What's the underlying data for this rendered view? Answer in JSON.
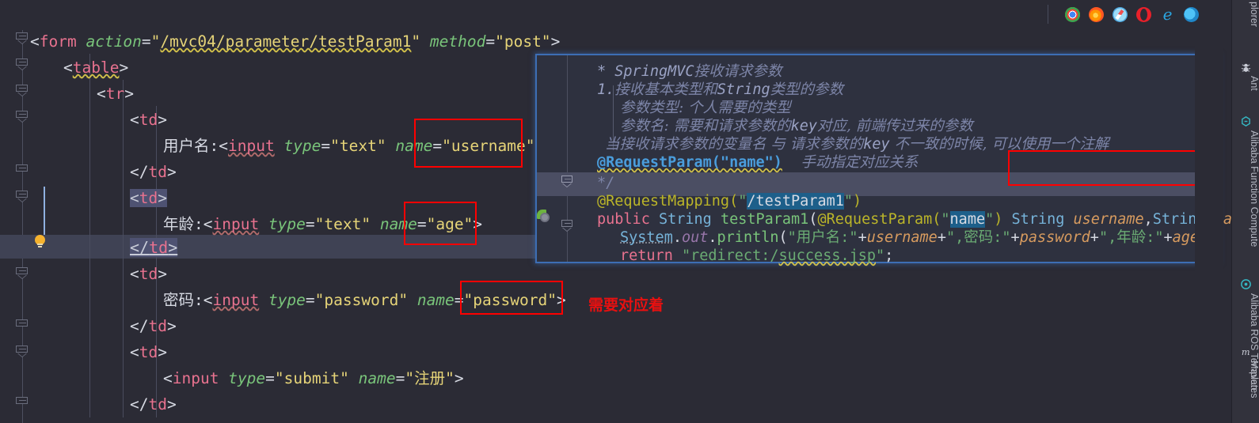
{
  "editor": {
    "file_language": "jsp",
    "lines": [
      {
        "id": "l1",
        "indent": 0,
        "text": "<form action=\"/mvc04/parameter/testParam1\" method=\"post\">"
      },
      {
        "id": "l2",
        "indent": 1,
        "text": "<table>"
      },
      {
        "id": "l3",
        "indent": 2,
        "text": "<tr>"
      },
      {
        "id": "l4",
        "indent": 3,
        "text": "<td>"
      },
      {
        "id": "l5",
        "indent": 4,
        "text": "用户名:<input type=\"text\" name=\"username\">"
      },
      {
        "id": "l6",
        "indent": 3,
        "text": "</td>"
      },
      {
        "id": "l7",
        "indent": 3,
        "text": "<td>"
      },
      {
        "id": "l8",
        "indent": 4,
        "text": "年龄:<input type=\"text\" name=\"age\">"
      },
      {
        "id": "l9",
        "indent": 3,
        "text": "</td>"
      },
      {
        "id": "l10",
        "indent": 3,
        "text": "<td>"
      },
      {
        "id": "l11",
        "indent": 4,
        "text": "密码:<input type=\"password\" name=\"password\">"
      },
      {
        "id": "l12",
        "indent": 3,
        "text": "</td>"
      },
      {
        "id": "l13",
        "indent": 3,
        "text": "<td>"
      },
      {
        "id": "l14",
        "indent": 4,
        "text": "<input type=\"submit\" name=\"注册\">"
      },
      {
        "id": "l15",
        "indent": 3,
        "text": "</td>"
      }
    ],
    "current_line_text": "</td>",
    "annotations": {
      "note_text": "需要对应着",
      "box_color": "#ff0000",
      "highlight_boxes": [
        "\"username\">",
        "\"age\">",
        "\"password\">"
      ]
    },
    "gutter": {
      "intention_bulb": "lightbulb-icon"
    }
  },
  "popup": {
    "title": "documentation-popup",
    "border_color": "#3d6eb4",
    "javadoc": [
      {
        "id": "d1",
        "text": "* SpringMVC接收请求参数"
      },
      {
        "id": "d2",
        "text": "1.接收基本类型和String类型的参数"
      },
      {
        "id": "d3",
        "text": "参数类型: 个人需要的类型"
      },
      {
        "id": "d4",
        "text": "参数名: 需要和请求参数的key对应, 前端传过来的参数"
      },
      {
        "id": "d5",
        "text": "当接收请求参数的变量名 与 请求参数的key 不一致的时候, 可以使用一个注解"
      },
      {
        "id": "d6",
        "annotation": "@RequestParam(\"name\")",
        "text": "手动指定对应关系"
      },
      {
        "id": "d7",
        "text": "*/"
      }
    ],
    "code": {
      "mapping_annotation": "@RequestMapping(\"/testParam1\")",
      "mapping_path": "/testParam1",
      "signature_prefix": "public String testParam1(@RequestParam(\"name\") String ",
      "signature_param_name": "name",
      "signature_boxed": "username,String password,Integer age)",
      "signature_suffix": "{",
      "println_line": "System.out.println(\"用户名:\"+username+\",密码:\"+password+\",年龄:\"+age);",
      "return_line": "return \"redirect:/success.jsp\";",
      "bean_icon": "spring-bean-icon"
    }
  },
  "right_sidebar": {
    "items": [
      {
        "id": "s1",
        "label": "plorer",
        "icon": ""
      },
      {
        "id": "s2",
        "label": "Ant",
        "icon": "ant-icon"
      },
      {
        "id": "s3",
        "label": "Alibaba Function Compute",
        "icon": "alibaba-fc-icon"
      },
      {
        "id": "s4",
        "label": "Alibaba ROS Templates",
        "icon": "alibaba-ros-icon"
      },
      {
        "id": "s5",
        "label": "Maven",
        "icon": "maven-icon"
      }
    ]
  },
  "browser_bar": {
    "icons": [
      {
        "id": "b1",
        "name": "chrome-icon",
        "color": "#4285f4"
      },
      {
        "id": "b2",
        "name": "firefox-icon",
        "color": "#ff7139"
      },
      {
        "id": "b3",
        "name": "safari-icon",
        "color": "#1b9df5"
      },
      {
        "id": "b4",
        "name": "opera-icon",
        "color": "#e8202a"
      },
      {
        "id": "b5",
        "name": "edge-legacy-icon",
        "color": "#1ebbee"
      },
      {
        "id": "b6",
        "name": "edge-icon",
        "color": "#2ba5e0"
      }
    ]
  },
  "scrollbar": {
    "thumb_color": "#9a5b84",
    "marks_color": "#c9a227",
    "mark_count": 6
  }
}
